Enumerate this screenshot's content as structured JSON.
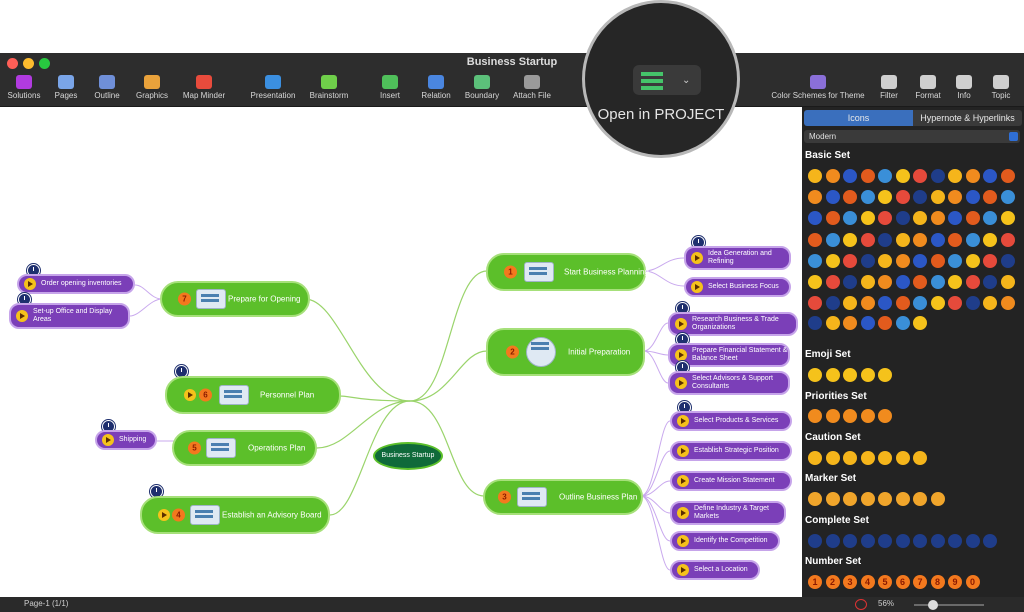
{
  "window": {
    "title": "Business Startup"
  },
  "toolbar": [
    {
      "label": "Solutions",
      "color": "#b13be0"
    },
    {
      "label": "Pages",
      "color": "#7aa5e8"
    },
    {
      "label": "Outline",
      "color": "#6f8fd8"
    },
    {
      "label": "Graphics",
      "color": "#e9a23b"
    },
    {
      "label": "Map Minder",
      "color": "#e84b3c"
    },
    {
      "label": "Presentation",
      "color": "#3b8fe0"
    },
    {
      "label": "Brainstorm",
      "color": "#6fcf4a"
    },
    {
      "label": "Insert",
      "color": "#4fbf5a"
    },
    {
      "label": "Relation",
      "color": "#4a86e0"
    },
    {
      "label": "Boundary",
      "color": "#5cc07a"
    },
    {
      "label": "Attach File",
      "color": "#9a9a9a"
    },
    {
      "label": "Color Schemes for Theme",
      "color": "#8a6fd8"
    },
    {
      "label": "Filter",
      "color": "#cfcfcf"
    },
    {
      "label": "Format",
      "color": "#cfcfcf"
    },
    {
      "label": "Info",
      "color": "#cfcfcf"
    },
    {
      "label": "Topic",
      "color": "#cfcfcf"
    }
  ],
  "magnifier": {
    "label": "Open in PROJECT"
  },
  "map": {
    "center": "Business Startup",
    "left_topics": [
      {
        "num": "7",
        "label": "Prepare for Opening"
      },
      {
        "num": "6",
        "label": "Personnel Plan"
      },
      {
        "num": "5",
        "label": "Operations Plan"
      },
      {
        "num": "4",
        "label": "Establish an Advisory Board"
      }
    ],
    "right_topics": [
      {
        "num": "1",
        "label": "Start Business Planning"
      },
      {
        "num": "2",
        "label": "Initial Preparation"
      },
      {
        "num": "3",
        "label": "Outline Business Plan"
      }
    ],
    "left_leaves": [
      "Order opening inventories",
      "Set-up Office and Display Areas",
      "Shipping"
    ],
    "right_leaves": {
      "planning": [
        "Idea Generation and Refining",
        "Select Business Focus"
      ],
      "preparation": [
        "Research Business & Trade Organizations",
        "Prepare Financial Statement & Balance Sheet",
        "Select Advisors & Support Consultants"
      ],
      "outline": [
        "Select Products & Services",
        "Establish Strategic Position",
        "Create Mission Statement",
        "Define Industry & Target Markets",
        "Identify the Competition",
        "Select a Location"
      ]
    }
  },
  "panel": {
    "tabs": [
      "Icons",
      "Hypernote & Hyperlinks"
    ],
    "theme": "Modern",
    "sections": [
      "Basic Set",
      "Emoji Set",
      "Priorities Set",
      "Caution Set",
      "Marker Set",
      "Complete Set",
      "Number Set"
    ],
    "number_set": [
      "1",
      "2",
      "3",
      "4",
      "5",
      "6",
      "7",
      "8",
      "9",
      "0"
    ]
  },
  "status": {
    "page": "Page-1 (1/1)",
    "zoom": "56%"
  }
}
